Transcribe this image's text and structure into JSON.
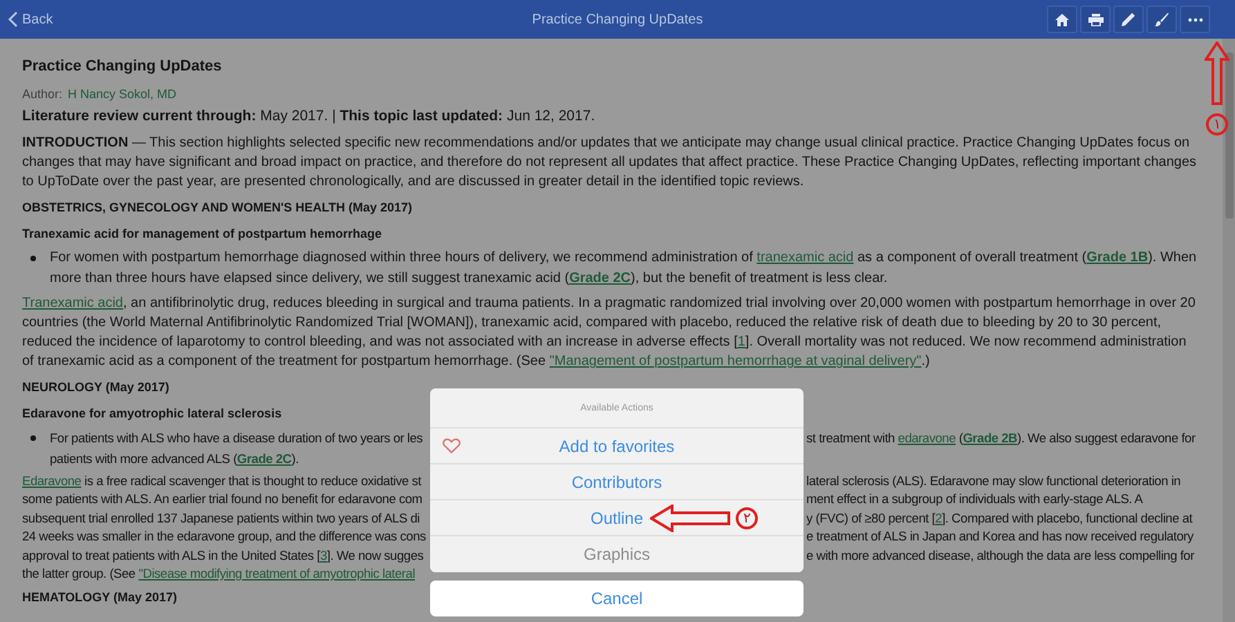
{
  "top_bar": {
    "back": "Back",
    "title": "Practice Changing UpDates",
    "actions": [
      {
        "kind": "home"
      },
      {
        "kind": "print"
      },
      {
        "kind": "pencil"
      },
      {
        "kind": "brush"
      },
      {
        "kind": "more"
      }
    ]
  },
  "article": {
    "title": "Practice Changing UpDates",
    "author_label": "Author:",
    "author": "H Nancy Sokol, MD",
    "review": "**Literature review current through:** May 2017. | **This topic last updated:** Jun 12, 2017.",
    "intro": "**INTRODUCTION** — This section highlights selected specific new recommendations and/or updates that we anticipate may change usual clinical practice. Practice Changing UpDates focus on changes that may have significant and broad impact on practice, and therefore do not represent all updates that affect practice. These Practice Changing UpDates, reflecting important changes to UpToDate over the past year, are presented chronologically, and are discussed in greater detail in the identified topic reviews.",
    "sections": [
      {
        "heading": "OBSTETRICS, GYNECOLOGY AND WOMEN'S HEALTH (May 2017)",
        "subheading": "Tranexamic acid for management of postpartum hemorrhage",
        "blocks": [
          {
            "kind": "bullet",
            "segments": [
              {
                "kind": "plain",
                "text": "For women with postpartum hemorrhage diagnosed within three hours of delivery, we recommend administration of "
              },
              {
                "kind": "link",
                "text": "tranexamic acid"
              },
              {
                "kind": "plain",
                "text": " as a component of overall treatment ("
              },
              {
                "kind": "grade",
                "text": "Grade 1B"
              },
              {
                "kind": "plain",
                "text": "). When more than three hours have elapsed since delivery, we still suggest tranexamic acid ("
              },
              {
                "kind": "grade",
                "text": "Grade 2C"
              },
              {
                "kind": "plain",
                "text": "), but the benefit of treatment is less clear."
              }
            ]
          },
          {
            "kind": "paragraph",
            "segments": [
              {
                "kind": "link",
                "text": "Tranexamic acid"
              },
              {
                "kind": "plain",
                "text": ", an antifibrinolytic drug, reduces bleeding in surgical and trauma patients. In a pragmatic randomized trial involving over 20,000 women with postpartum hemorrhage in over 20 countries (the World Maternal Antifibrinolytic Randomized Trial [WOMAN]), tranexamic acid, compared with placebo, reduced the relative risk of death due to bleeding by 20 to 30 percent, reduced the incidence of laparotomy to control bleeding, and was not associated with an increase in adverse effects ["
              },
              {
                "kind": "link",
                "text": "1"
              },
              {
                "kind": "plain",
                "text": "]. Overall mortality was not reduced. We now recommend administration of tranexamic acid as a component of the treatment for postpartum hemorrhage. (See "
              },
              {
                "kind": "link",
                "text": "\"Management of postpartum hemorrhage at vaginal delivery\""
              },
              {
                "kind": "plain",
                "text": ".)"
              }
            ]
          }
        ]
      },
      {
        "heading": "NEUROLOGY (May 2017)",
        "subheading": "Edaravone for amyotrophic lateral sclerosis",
        "blocks": [
          {
            "kind": "bullet",
            "lines": [
              {
                "left": [
                  {
                    "kind": "plain",
                    "text": "For patients with ALS who have a disease duration of two years or les"
                  }
                ],
                "right": [
                  {
                    "kind": "plain",
                    "text": "st treatment with "
                  },
                  {
                    "kind": "link",
                    "text": "edaravone"
                  },
                  {
                    "kind": "plain",
                    "text": " ("
                  },
                  {
                    "kind": "grade",
                    "text": "Grade 2B"
                  },
                  {
                    "kind": "plain",
                    "text": "). We also suggest edaravone for"
                  }
                ]
              },
              {
                "left": [
                  {
                    "kind": "plain",
                    "text": "patients with more advanced ALS ("
                  },
                  {
                    "kind": "grade",
                    "text": "Grade 2C"
                  },
                  {
                    "kind": "plain",
                    "text": ")."
                  }
                ]
              }
            ]
          },
          {
            "kind": "paragraph",
            "lines": [
              {
                "left": [
                  {
                    "kind": "link",
                    "text": "Edaravone"
                  },
                  {
                    "kind": "plain",
                    "text": " is a free radical scavenger that is thought to reduce oxidative st"
                  }
                ],
                "right": [
                  {
                    "kind": "plain",
                    "text": "lateral sclerosis (ALS). Edaravone may slow functional deterioration in"
                  }
                ]
              },
              {
                "left": [
                  {
                    "kind": "plain",
                    "text": "some patients with ALS. An earlier trial found no benefit for edaravone com"
                  }
                ],
                "right": [
                  {
                    "kind": "plain",
                    "text": "ment effect in a subgroup of individuals with early-stage ALS. A"
                  }
                ]
              },
              {
                "left": [
                  {
                    "kind": "plain",
                    "text": "subsequent trial enrolled 137 Japanese patients within two years of ALS di"
                  }
                ],
                "right": [
                  {
                    "kind": "plain",
                    "text": "y (FVC) of ≥80 percent ["
                  },
                  {
                    "kind": "link",
                    "text": "2"
                  },
                  {
                    "kind": "plain",
                    "text": "]. Compared with placebo, functional decline at"
                  }
                ]
              },
              {
                "left": [
                  {
                    "kind": "plain",
                    "text": "24 weeks was smaller in the edaravone group, and the difference was cons"
                  }
                ],
                "right": [
                  {
                    "kind": "plain",
                    "text": "e treatment of ALS in Japan and Korea and has now received regulatory"
                  }
                ]
              },
              {
                "left": [
                  {
                    "kind": "plain",
                    "text": "approval to treat patients with ALS in the United States ["
                  },
                  {
                    "kind": "link",
                    "text": "3"
                  },
                  {
                    "kind": "plain",
                    "text": "]. We now sugges"
                  }
                ],
                "right": [
                  {
                    "kind": "plain",
                    "text": "e with more advanced disease, although the data are less compelling for"
                  }
                ]
              },
              {
                "left": [
                  {
                    "kind": "plain",
                    "text": "the latter group. (See "
                  },
                  {
                    "kind": "link",
                    "text": "\"Disease modifying treatment of amyotrophic lateral"
                  }
                ]
              }
            ]
          }
        ]
      },
      {
        "heading": "HEMATOLOGY (May 2017)"
      }
    ]
  },
  "action_sheet": {
    "header": "Available Actions",
    "items": [
      {
        "kind": "favorite",
        "label": "Add to favorites",
        "disabled": false
      },
      {
        "kind": "action",
        "label": "Contributors",
        "disabled": false
      },
      {
        "kind": "action",
        "label": "Outline",
        "disabled": false
      },
      {
        "kind": "action",
        "label": "Graphics",
        "disabled": true
      }
    ],
    "cancel": "Cancel"
  },
  "annotations": [
    {
      "kind": "arrow_up",
      "label": "١"
    },
    {
      "kind": "arrow_left",
      "label": "٢"
    }
  ]
}
